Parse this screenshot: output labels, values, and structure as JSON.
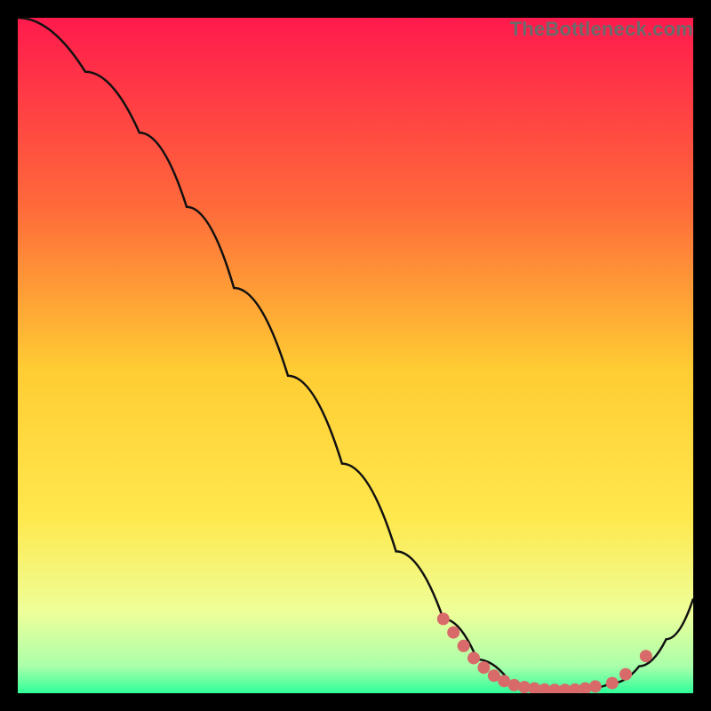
{
  "watermark": "TheBottleneck.com",
  "chart_data": {
    "type": "line",
    "title": "",
    "xlabel": "",
    "ylabel": "",
    "xlim": [
      0,
      100
    ],
    "ylim": [
      0,
      100
    ],
    "grid": false,
    "legend": false,
    "background_gradient": {
      "top": "#ff1a4d",
      "upper_mid": "#ff944d",
      "mid": "#ffe84d",
      "lower_mid": "#f7ff8a",
      "bottom": "#2fff99"
    },
    "curve": [
      {
        "x": 0,
        "y": 100
      },
      {
        "x": 10,
        "y": 92
      },
      {
        "x": 18,
        "y": 83
      },
      {
        "x": 25,
        "y": 72
      },
      {
        "x": 32,
        "y": 60
      },
      {
        "x": 40,
        "y": 47
      },
      {
        "x": 48,
        "y": 34
      },
      {
        "x": 56,
        "y": 21
      },
      {
        "x": 63,
        "y": 11
      },
      {
        "x": 68,
        "y": 5
      },
      {
        "x": 73,
        "y": 1.5
      },
      {
        "x": 78,
        "y": 0.5
      },
      {
        "x": 83,
        "y": 0.5
      },
      {
        "x": 88,
        "y": 1.5
      },
      {
        "x": 92,
        "y": 4
      },
      {
        "x": 96,
        "y": 8
      },
      {
        "x": 100,
        "y": 14
      }
    ],
    "markers": [
      {
        "x": 63,
        "y": 11
      },
      {
        "x": 64.5,
        "y": 9
      },
      {
        "x": 66,
        "y": 7
      },
      {
        "x": 67.5,
        "y": 5.2
      },
      {
        "x": 69,
        "y": 3.8
      },
      {
        "x": 70.5,
        "y": 2.6
      },
      {
        "x": 72,
        "y": 1.8
      },
      {
        "x": 73.5,
        "y": 1.2
      },
      {
        "x": 75,
        "y": 0.9
      },
      {
        "x": 76.5,
        "y": 0.7
      },
      {
        "x": 78,
        "y": 0.55
      },
      {
        "x": 79.5,
        "y": 0.5
      },
      {
        "x": 81,
        "y": 0.5
      },
      {
        "x": 82.5,
        "y": 0.55
      },
      {
        "x": 84,
        "y": 0.7
      },
      {
        "x": 85.5,
        "y": 1.0
      },
      {
        "x": 88,
        "y": 1.5
      },
      {
        "x": 90,
        "y": 2.8
      },
      {
        "x": 93,
        "y": 5.5
      }
    ],
    "marker_color": "#d96a6a",
    "marker_radius": 7,
    "curve_color": "#111111",
    "curve_width": 2.5
  }
}
